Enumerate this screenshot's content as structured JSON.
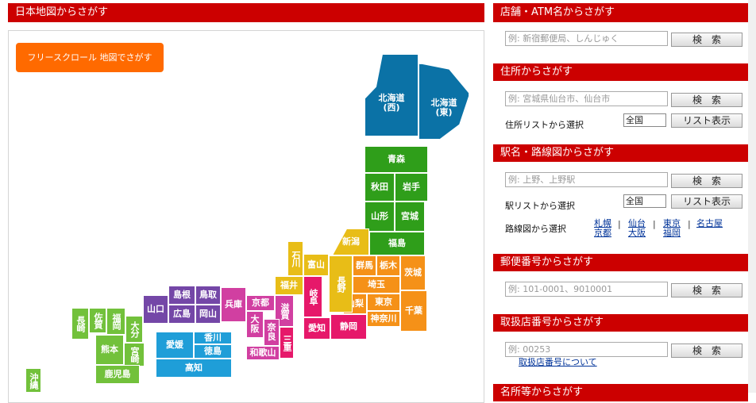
{
  "map": {
    "header": "日本地図からさがす",
    "scroll_button": "フリースクロール 地図でさがす",
    "regions": {
      "hokkaido_west": "北海道(西)",
      "hokkaido_east": "北海道(東)",
      "aomori": "青森",
      "akita": "秋田",
      "iwate": "岩手",
      "yamagata": "山形",
      "miyagi": "宮城",
      "fukushima": "福島",
      "niigata": "新潟",
      "gunma": "群馬",
      "tochigi": "栃木",
      "ibaraki": "茨城",
      "saitama": "埼玉",
      "tokyo": "東京",
      "yamanashi": "山梨",
      "kanagawa": "神奈川",
      "chiba": "千葉",
      "ishikawa": "石川",
      "toyama": "富山",
      "fukui": "福井",
      "nagano": "長野",
      "gifu": "岐阜",
      "shizuoka": "静岡",
      "aichi": "愛知",
      "kyoto": "京都",
      "shiga": "滋賀",
      "osaka": "大阪",
      "hyogo": "兵庫",
      "nara": "奈良",
      "mie": "三重",
      "wakayama": "和歌山",
      "shimane": "島根",
      "tottori": "鳥取",
      "yamaguchi": "山口",
      "hiroshima": "広島",
      "okayama": "岡山",
      "ehime": "愛媛",
      "kagawa": "香川",
      "tokushima": "徳島",
      "kochi": "高知",
      "nagasaki": "長崎",
      "saga": "佐賀",
      "fukuoka": "福岡",
      "oita": "大分",
      "kumamoto": "熊本",
      "miyazaki": "宮崎",
      "kagoshima": "鹿児島",
      "okinawa": "沖縄"
    }
  },
  "store_search": {
    "header": "店舗・ATM名からさがす",
    "placeholder": "例: 新宿郵便局、しんじゅく",
    "button": "検　索"
  },
  "address_search": {
    "header": "住所からさがす",
    "placeholder": "例: 宮城県仙台市、仙台市",
    "button": "検　索",
    "list_label": "住所リストから選択",
    "select_value": "全国",
    "list_button": "リスト表示"
  },
  "station_search": {
    "header": "駅名・路線図からさがす",
    "placeholder": "例: 上野、上野駅",
    "button": "検　索",
    "list_label": "駅リストから選択",
    "select_value": "全国",
    "list_button": "リスト表示",
    "route_label": "路線図から選択",
    "route_links": [
      "札幌",
      "京都",
      "仙台",
      "大阪",
      "東京",
      "福岡",
      "名古屋"
    ],
    "separator": "|"
  },
  "postal_search": {
    "header": "郵便番号からさがす",
    "placeholder": "例: 101-0001、9010001",
    "button": "検　索"
  },
  "branch_search": {
    "header": "取扱店番号からさがす",
    "placeholder": "例: 00253",
    "button": "検　索",
    "about_link": "取扱店番号について"
  },
  "bottom_header": "名所等からさがす"
}
